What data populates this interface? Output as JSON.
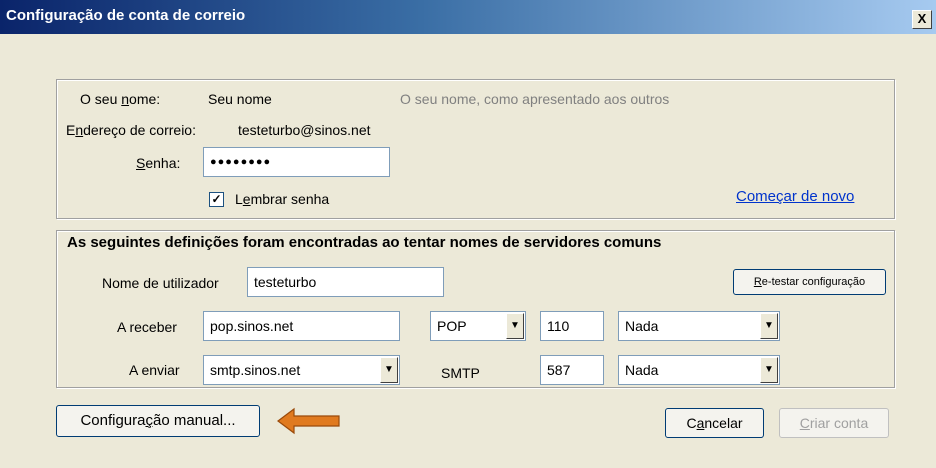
{
  "window": {
    "title": "Configuração de conta de correio",
    "close_glyph": "X"
  },
  "identity": {
    "name_label": "O seu nome:",
    "name_value": "Seu nome",
    "name_hint": "O seu nome, como apresentado aos outros",
    "email_label": "Endereço de correio:",
    "email_value": "testeturbo@sinos.net",
    "password_label": "Senha:",
    "password_value": "●●●●●●●●",
    "remember_checked": true,
    "remember_label": "Lembrar senha",
    "restart_link": "Começar de novo"
  },
  "servers": {
    "heading": "As seguintes definições foram encontradas ao tentar nomes de servidores comuns",
    "username_label": "Nome de utilizador",
    "username_value": "testeturbo",
    "retest_button": "Re-testar configuração",
    "incoming": {
      "label": "A receber",
      "host": "pop.sinos.net",
      "protocol": "POP",
      "port": "110",
      "security": "Nada"
    },
    "outgoing": {
      "label": "A enviar",
      "host": "smtp.sinos.net",
      "protocol": "SMTP",
      "port": "587",
      "security": "Nada"
    }
  },
  "footer": {
    "manual_button": "Configuração manual...",
    "cancel_button": "Cancelar",
    "create_button": "Criar conta"
  },
  "icons": {
    "arrow": "left-arrow-icon",
    "dropdown": "chevron-down-icon",
    "check": "checkmark-icon"
  },
  "colors": {
    "arrow_fill": "#e07a1f",
    "link": "#0033cc",
    "titlebar": "#0a246a"
  }
}
